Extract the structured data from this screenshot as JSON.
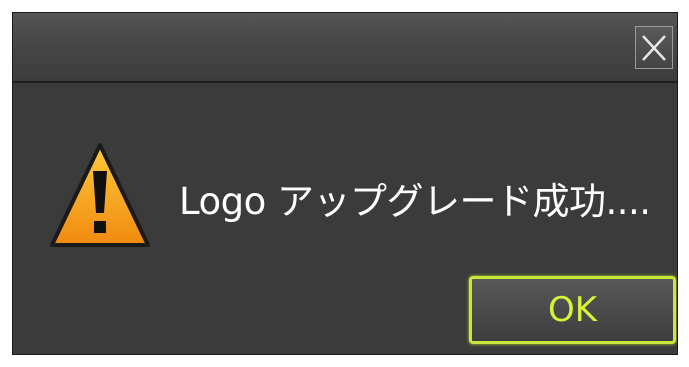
{
  "dialog": {
    "title": "",
    "close_icon": "close-icon",
    "warning_icon": "warning-triangle-icon",
    "message": "Logo アップグレード成功....",
    "ok_label": "OK"
  },
  "colors": {
    "background": "#3b3b3b",
    "titlebar": "#474747",
    "text": "#ffffff",
    "ok_border": "#c8e83a",
    "ok_text": "#d8f23a",
    "warning_fill": "#f5a623"
  }
}
